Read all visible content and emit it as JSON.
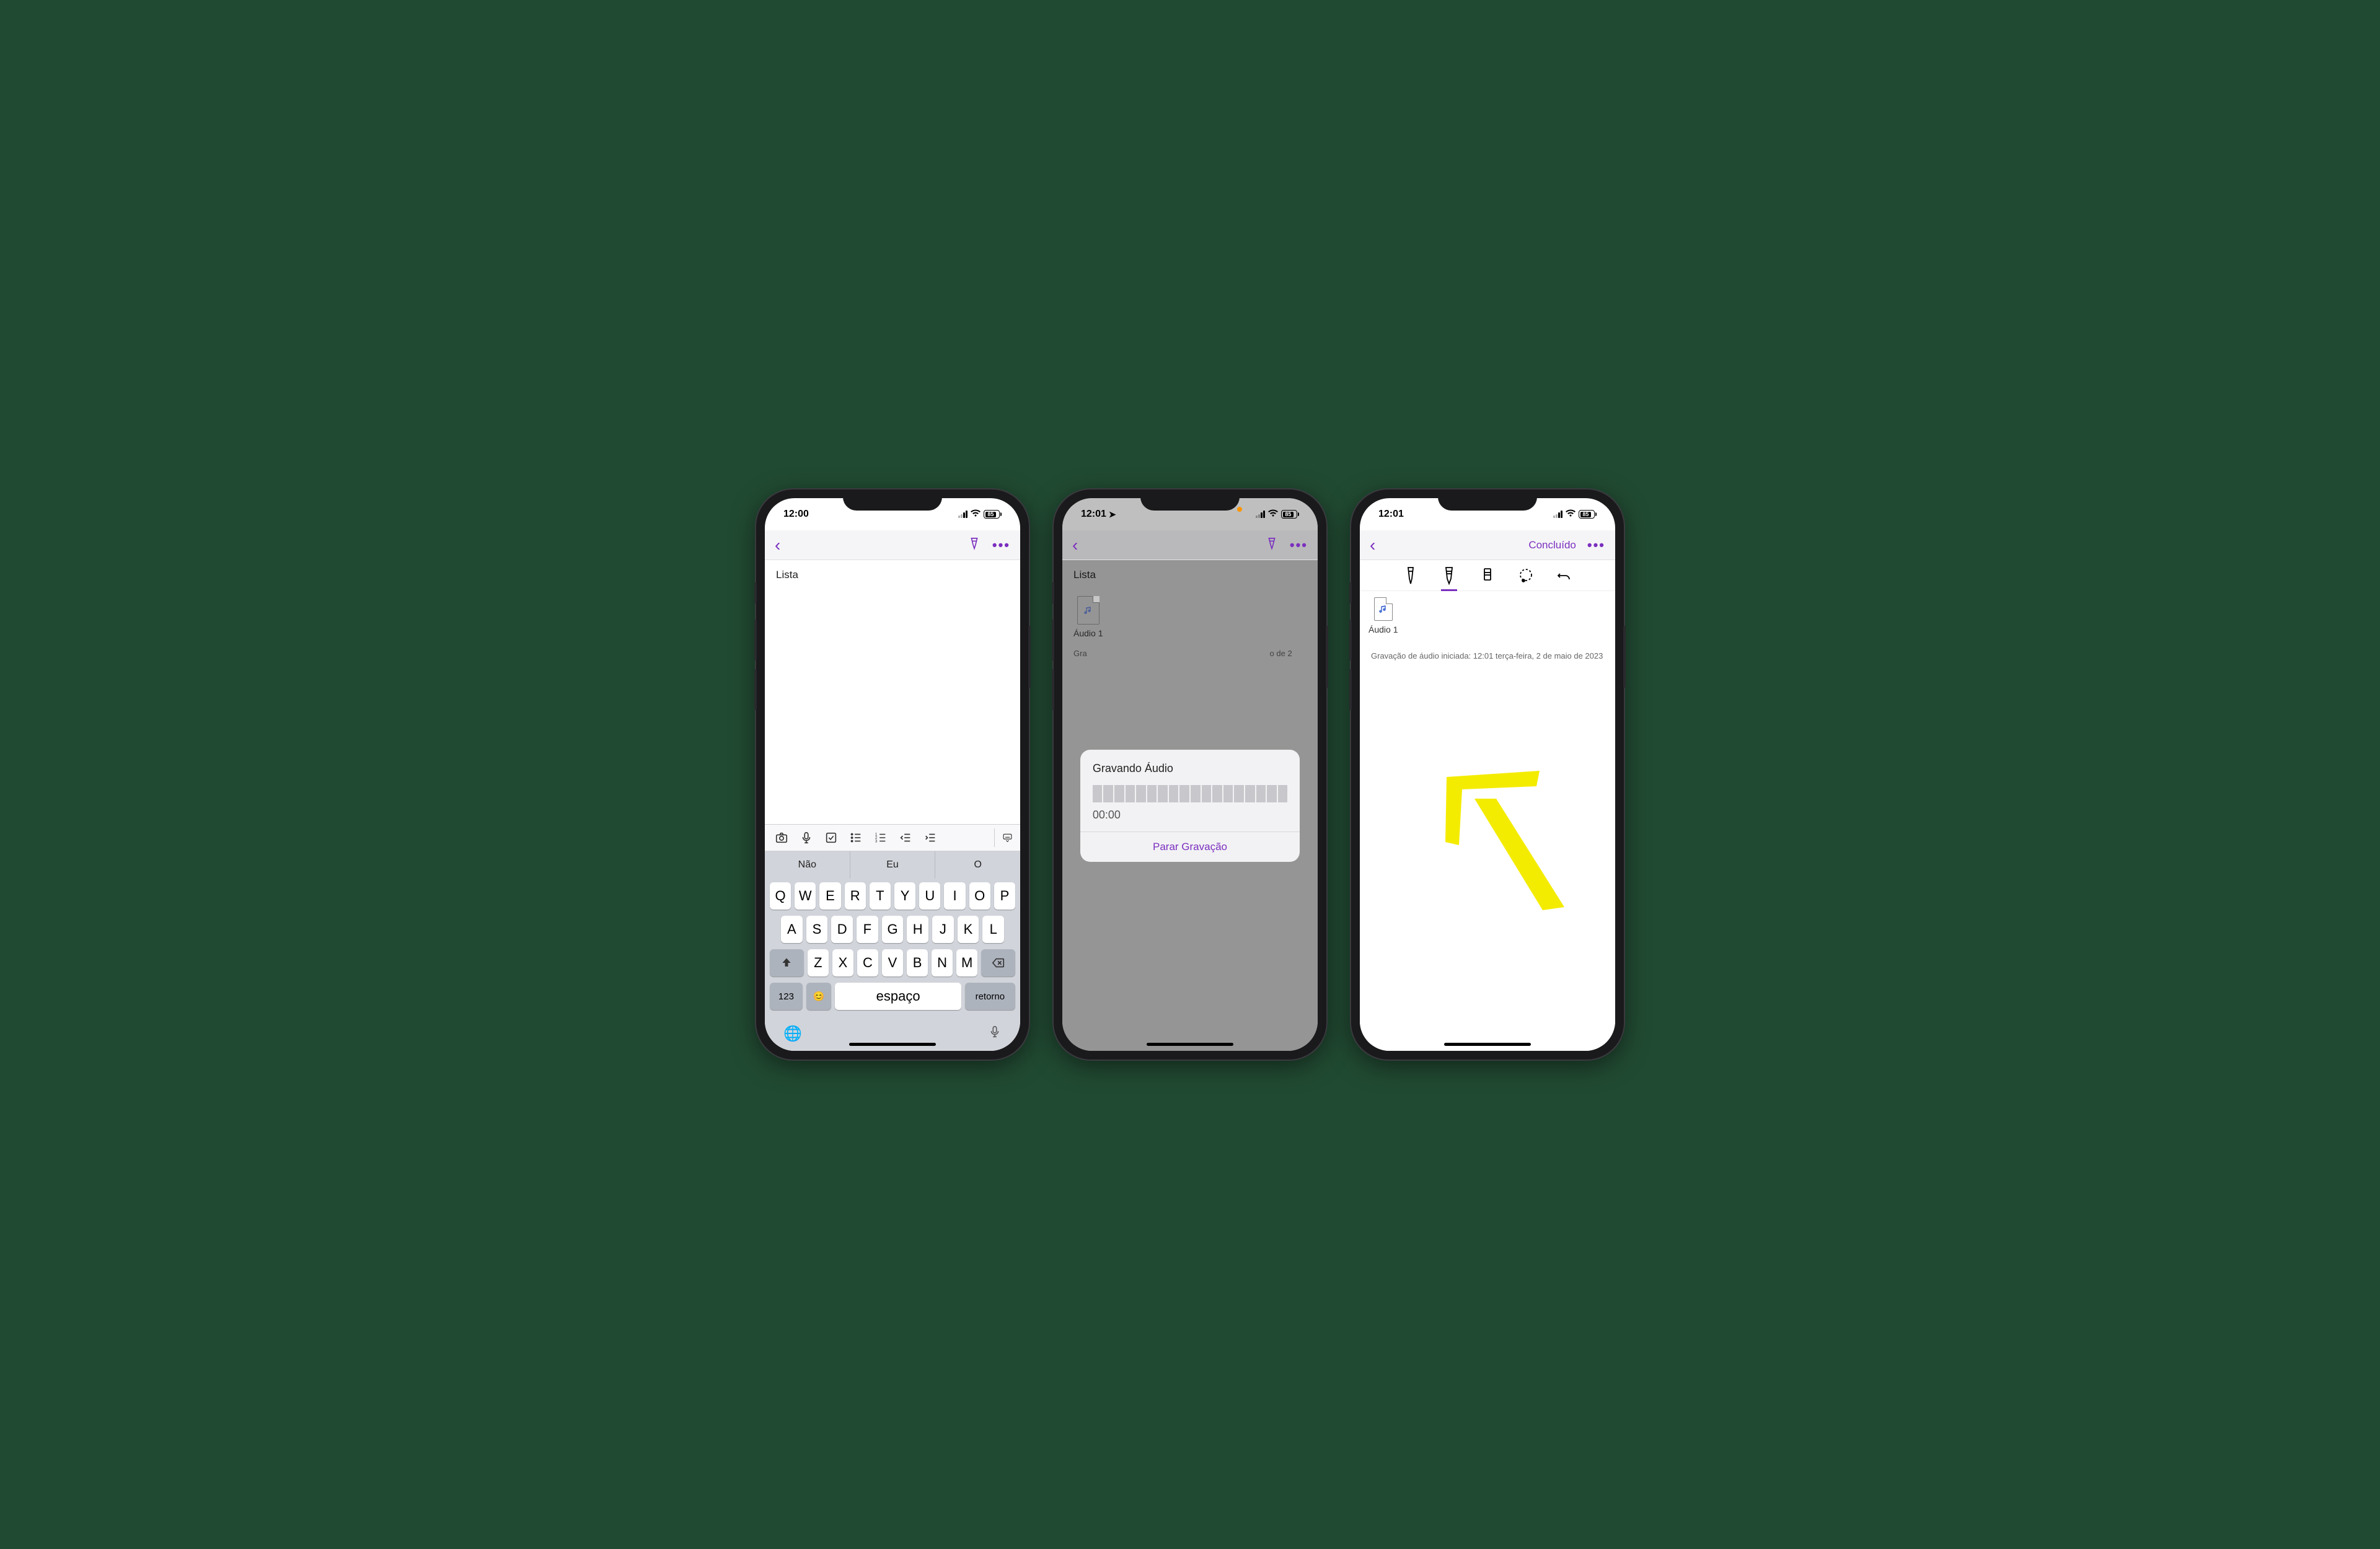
{
  "status": {
    "battery_pct": "85"
  },
  "screen1": {
    "time": "12:00",
    "title": "Lista",
    "suggestions": [
      "Não",
      "Eu",
      "O"
    ],
    "rows": [
      [
        "Q",
        "W",
        "E",
        "R",
        "T",
        "Y",
        "U",
        "I",
        "O",
        "P"
      ],
      [
        "A",
        "S",
        "D",
        "F",
        "G",
        "H",
        "J",
        "K",
        "L"
      ],
      [
        "Z",
        "X",
        "C",
        "V",
        "B",
        "N",
        "M"
      ]
    ],
    "key_123": "123",
    "key_space": "espaço",
    "key_return": "retorno"
  },
  "screen2": {
    "time": "12:01",
    "title": "Lista",
    "audio_label": "Áudio 1",
    "rec_note_prefix": "Gra",
    "rec_note_suffix": "o de 2",
    "modal_title": "Gravando Áudio",
    "modal_time": "00:00",
    "modal_stop": "Parar Gravação"
  },
  "screen3": {
    "time": "12:01",
    "done": "Concluído",
    "audio_label": "Áudio 1",
    "rec_note": "Gravação de áudio iniciada: 12:01 terça-feira, 2 de maio de 2023"
  }
}
